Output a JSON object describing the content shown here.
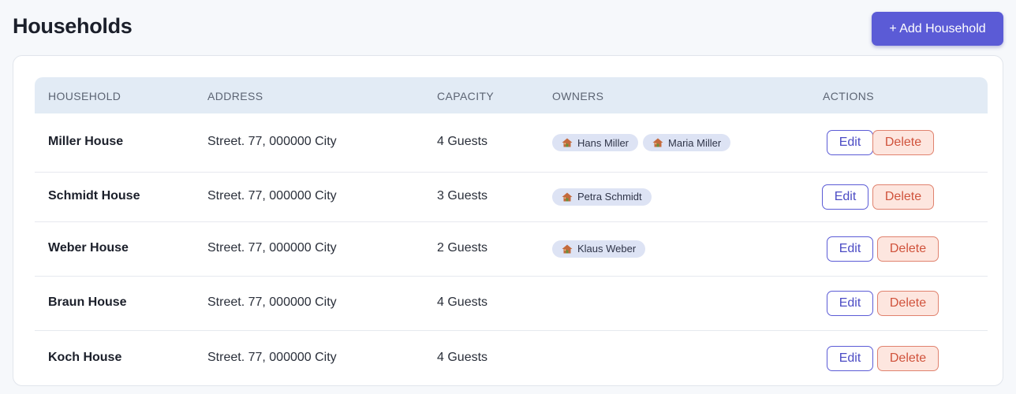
{
  "header": {
    "title": "Households",
    "add_button_label": "+ Add Household"
  },
  "table": {
    "columns": [
      "HOUSEHOLD",
      "ADDRESS",
      "CAPACITY",
      "OWNERS",
      "ACTIONS"
    ],
    "edit_label": "Edit",
    "delete_label": "Delete",
    "rows": [
      {
        "name": "Miller House",
        "address": "Street. 77, 000000 City",
        "capacity": "4 Guests",
        "owners": [
          "Hans Miller",
          "Maria Miller"
        ]
      },
      {
        "name": "Schmidt House",
        "address": "Street. 77, 000000 City",
        "capacity": "3 Guests",
        "owners": [
          "Petra Schmidt"
        ]
      },
      {
        "name": "Weber House",
        "address": "Street. 77, 000000 City",
        "capacity": "2 Guests",
        "owners": [
          "Klaus Weber"
        ]
      },
      {
        "name": "Braun House",
        "address": "Street. 77, 000000 City",
        "capacity": "4 Guests",
        "owners": []
      },
      {
        "name": "Koch House",
        "address": "Street. 77, 000000 City",
        "capacity": "4 Guests",
        "owners": []
      }
    ]
  },
  "colors": {
    "accent": "#5b5bd6",
    "delete": "#d0533c",
    "header_bg": "#e2ebf5",
    "chip_bg": "#dde3f4"
  }
}
